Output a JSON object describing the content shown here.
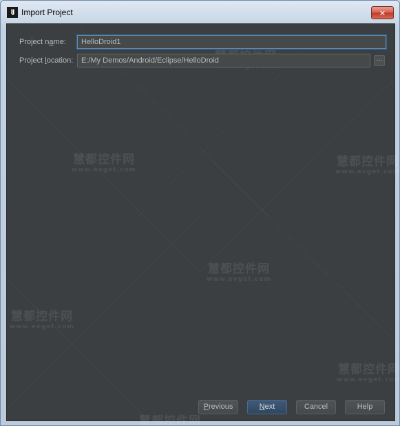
{
  "window": {
    "title": "Import Project",
    "app_icon_text": "IJ",
    "close_label": "✕"
  },
  "form": {
    "name_label": "Project name:",
    "name_value": "HelloDroid1",
    "location_label": "Project location:",
    "location_value": "E:/My Demos/Android/Eclipse/HelloDroid",
    "browse_label": "..."
  },
  "buttons": {
    "previous": "Previous",
    "next": "Next",
    "cancel": "Cancel",
    "help": "Help"
  },
  "watermark": {
    "brand": "慧都控件网",
    "url": "www.evget.com"
  }
}
